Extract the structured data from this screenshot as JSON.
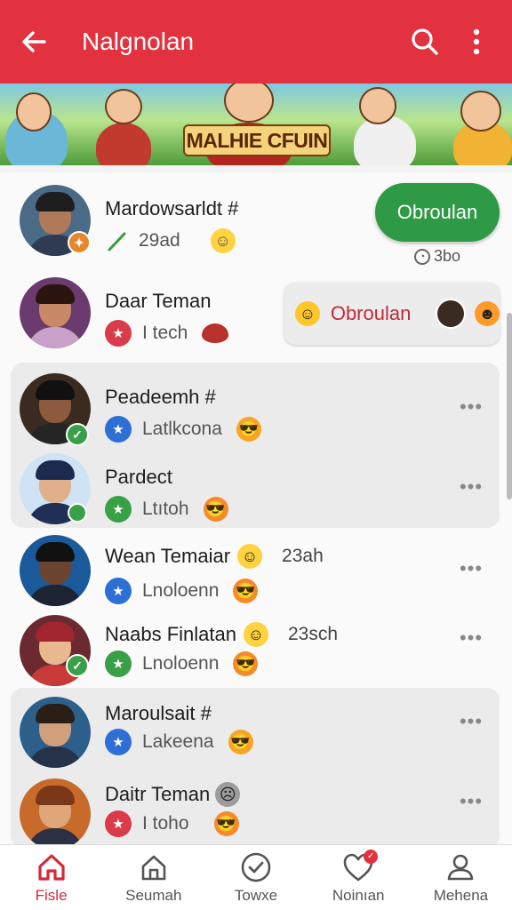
{
  "appbar": {
    "title": "Nalgnolan",
    "back_icon": "arrow-left-icon",
    "search_icon": "search-icon",
    "more_icon": "more-vertical-icon",
    "color": "#e2313f"
  },
  "banner": {
    "text": "MALHIE CFUIN"
  },
  "action_card": {
    "primary_label": "Obroulan",
    "counter": "3bo",
    "secondary_label": "Obroulan"
  },
  "contacts": [
    {
      "name": "Mardowsarldt #",
      "sub": "29ad",
      "badge_icon": "pen-icon",
      "emoji": "smile-emoji"
    },
    {
      "name": "Daar Teman",
      "sub": "I tech",
      "badge_icon": "star-icon",
      "emoji": "rugby-ball-emoji"
    },
    {
      "name": "Peadeemh #",
      "sub": "Latlkcona",
      "badge_icon": "star-icon",
      "emoji": "sunglasses-emoji"
    },
    {
      "name": "Pardect",
      "sub": "Ltıtoh",
      "badge_icon": "star-icon",
      "emoji": "cool-emoji"
    },
    {
      "name": "Wean Temaiar",
      "time": "23ah",
      "sub": "Lnoloenn",
      "badge_icon": "star-icon",
      "emoji": "cool-emoji"
    },
    {
      "name": "Naabs Finlatan",
      "time": "23sch",
      "sub": "Lnoloenn",
      "badge_icon": "star-icon",
      "emoji": "cool-emoji"
    },
    {
      "name": "Maroulsait #",
      "sub": "Lakeena",
      "badge_icon": "star-icon",
      "emoji": "sunglasses-emoji"
    },
    {
      "name": "Daitr Teman",
      "sub": "I toho",
      "badge_icon": "star-icon",
      "emoji": "cool-emoji"
    }
  ],
  "bottom_nav": [
    {
      "label": "Fisle",
      "icon": "home-icon",
      "active": true
    },
    {
      "label": "Seumah",
      "icon": "home-outline-icon",
      "active": false
    },
    {
      "label": "Towxe",
      "icon": "check-circle-icon",
      "active": false
    },
    {
      "label": "Noinıan",
      "icon": "heart-icon",
      "active": false
    },
    {
      "label": "Mehena",
      "icon": "person-icon",
      "active": false
    }
  ],
  "colors": {
    "accent": "#e2313f",
    "primary_button": "#2f9a45",
    "badge_blue": "#2e6fd6",
    "badge_green": "#38a046",
    "badge_red": "#d93b4a"
  }
}
